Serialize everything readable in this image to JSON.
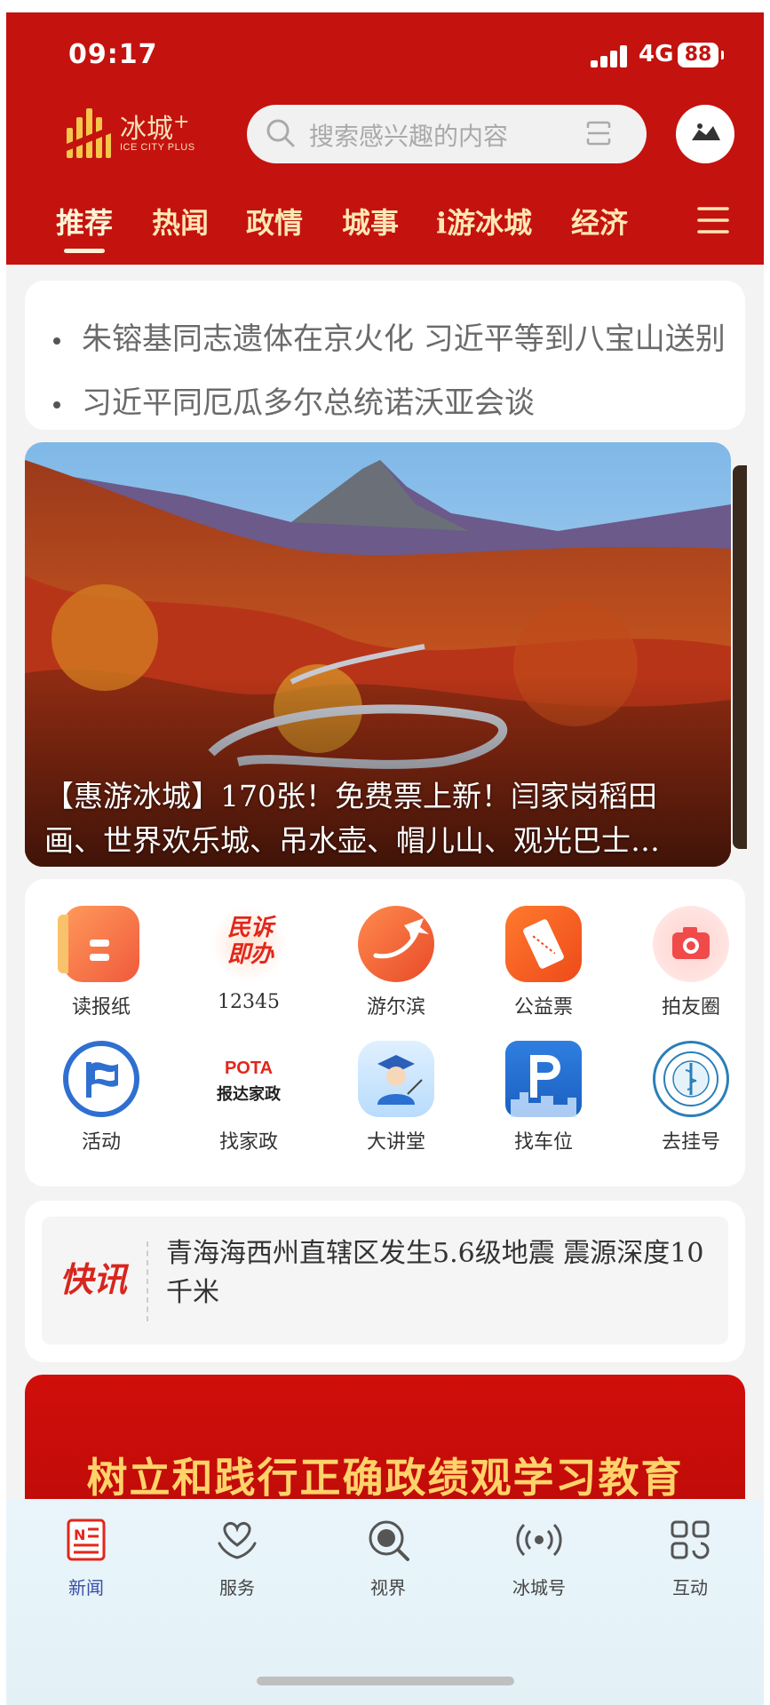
{
  "status_bar": {
    "time": "09:17",
    "network": "4G",
    "battery": "88"
  },
  "header": {
    "logo_cn": "冰城",
    "logo_plus": "+",
    "logo_en": "ICE CITY PLUS",
    "search_placeholder": "搜索感兴趣的内容"
  },
  "tabs": [
    "推荐",
    "热闻",
    "政情",
    "城事",
    "i游冰城",
    "经济"
  ],
  "headlines": [
    "朱镕基同志遗体在京火化 习近平等到八宝山送别",
    "习近平同厄瓜多尔总统诺沃亚会谈"
  ],
  "banner": {
    "caption_line1": "【惠游冰城】170张！免费票上新！闫家岗稻田",
    "caption_line2": "画、世界欢乐城、吊水壶、帽儿山、观光巴士…"
  },
  "services": [
    {
      "label": "读报纸",
      "icon": "newspaper-icon"
    },
    {
      "label": "12345",
      "icon": "citizen-hotline-icon"
    },
    {
      "label": "游尔滨",
      "icon": "plane-icon"
    },
    {
      "label": "公益票",
      "icon": "ticket-icon"
    },
    {
      "label": "拍友圈",
      "icon": "camera-icon"
    },
    {
      "label": "活动",
      "icon": "flag-icon"
    },
    {
      "label": "找家政",
      "icon": "housekeeping-icon"
    },
    {
      "label": "大讲堂",
      "icon": "lecture-icon"
    },
    {
      "label": "找车位",
      "icon": "parking-icon"
    },
    {
      "label": "去挂号",
      "icon": "hospital-icon"
    }
  ],
  "service_icon_text": {
    "hotline_line1": "民诉",
    "hotline_line2": "即办",
    "pota": "POTA",
    "housekeeping": "报达家政"
  },
  "flash": {
    "tag": "快讯",
    "text": "青海海西州直辖区发生5.6级地震 震源深度10千米"
  },
  "promo_banner": {
    "text": "树立和践行正确政绩观学习教育"
  },
  "bottom_nav": [
    {
      "label": "新闻",
      "active": true
    },
    {
      "label": "服务",
      "active": false
    },
    {
      "label": "视界",
      "active": false
    },
    {
      "label": "冰城号",
      "active": false
    },
    {
      "label": "互动",
      "active": false
    }
  ],
  "colors": {
    "brand_red": "#c4120f",
    "tab_text": "#ffe7b4",
    "active_nav": "#3b4da8",
    "promo_text": "#ffd36a"
  }
}
